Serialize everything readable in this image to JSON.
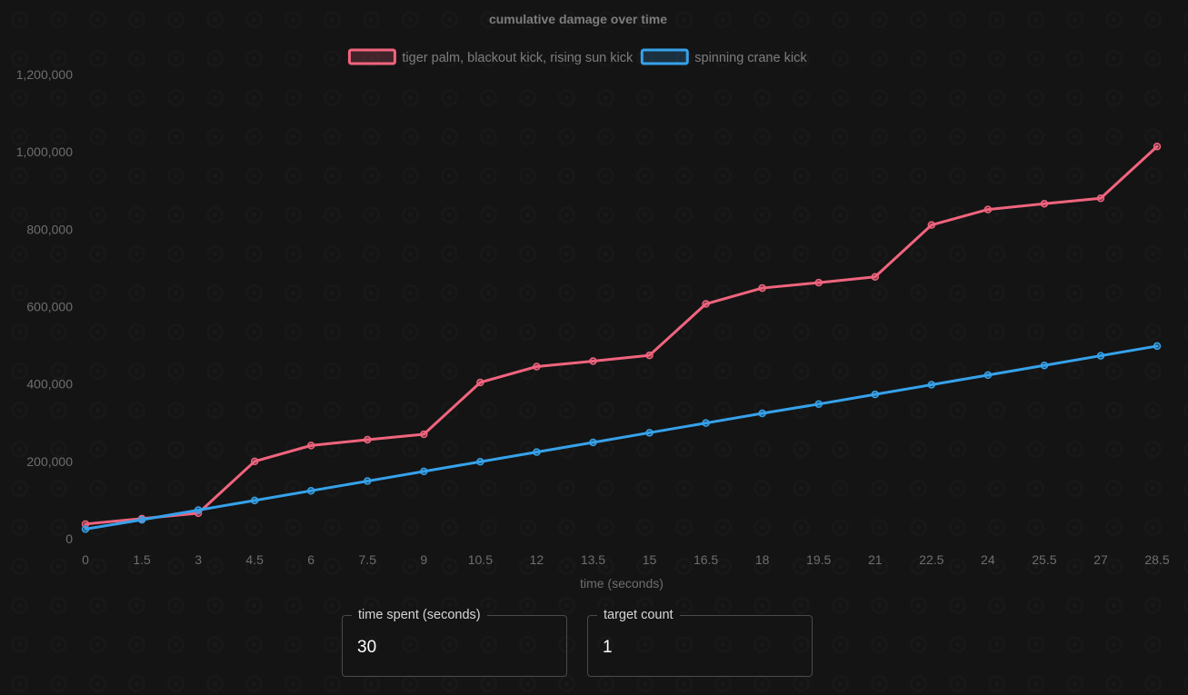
{
  "colors": {
    "background": "#141414",
    "series_pink": "#f0647e",
    "series_blue": "#36a2eb",
    "axis_text": "#6e6e6e",
    "title_text": "#7d7d7d"
  },
  "chart_data": {
    "type": "line",
    "title": "cumulative damage over time",
    "xlabel": "time (seconds)",
    "ylabel": "",
    "x": [
      0,
      1.5,
      3,
      4.5,
      6,
      7.5,
      9,
      10.5,
      12,
      13.5,
      15,
      16.5,
      18,
      19.5,
      21,
      22.5,
      24,
      25.5,
      27,
      28.5
    ],
    "x_tick_labels": [
      "0",
      "1.5",
      "3",
      "4.5",
      "6",
      "7.5",
      "9",
      "10.5",
      "12",
      "13.5",
      "15",
      "16.5",
      "18",
      "19.5",
      "21",
      "22.5",
      "24",
      "25.5",
      "27",
      "28.5"
    ],
    "y_ticks": [
      0,
      200000,
      400000,
      600000,
      800000,
      1000000,
      1200000
    ],
    "y_tick_labels": [
      "0",
      "200,000",
      "400,000",
      "600,000",
      "800,000",
      "1,000,000",
      "1,200,000"
    ],
    "ylim": [
      0,
      1200000
    ],
    "grid": false,
    "legend_position": "top-center",
    "series": [
      {
        "name": "tiger palm, blackout kick, rising sun kick",
        "color": "#f0647e",
        "values": [
          38000,
          52000,
          66000,
          200000,
          241000,
          256000,
          270000,
          404000,
          445000,
          459000,
          474000,
          607000,
          648000,
          662000,
          677000,
          811000,
          851000,
          866000,
          880000,
          1014000
        ]
      },
      {
        "name": "spinning crane kick",
        "color": "#36a2eb",
        "values": [
          25000,
          49000,
          74000,
          99000,
          124000,
          149000,
          174000,
          199000,
          224000,
          249000,
          274000,
          299000,
          324000,
          348000,
          373000,
          398000,
          423000,
          448000,
          473000,
          498000
        ]
      }
    ]
  },
  "controls": {
    "time_spent": {
      "label": "time spent (seconds)",
      "value": "30"
    },
    "target_count": {
      "label": "target count",
      "value": "1"
    }
  }
}
